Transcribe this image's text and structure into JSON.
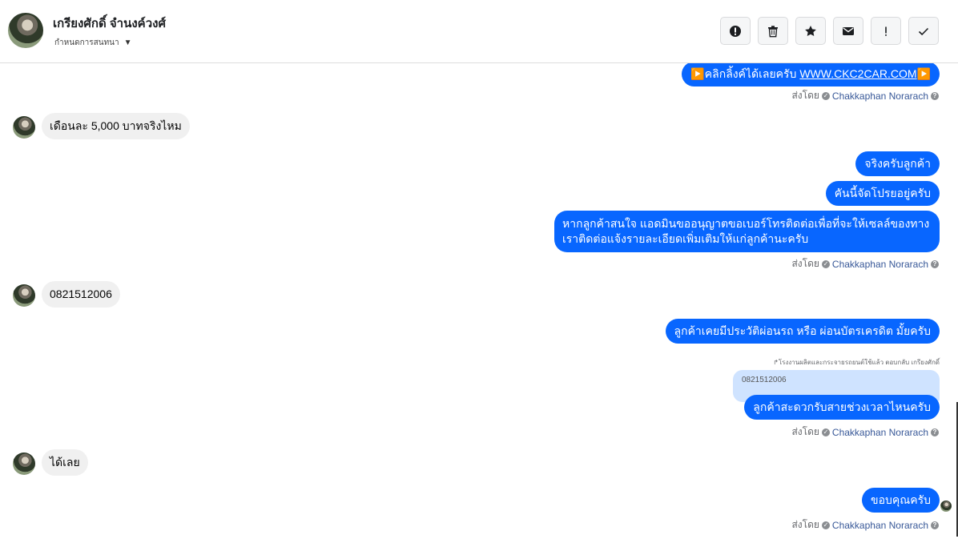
{
  "header": {
    "contact_name": "เกรียงศักดิ์ จำนงค์วงศ์",
    "assign_label": "กำหนดการสนทนา",
    "caret": "▼"
  },
  "toolbar": {
    "buttons": [
      {
        "name": "report",
        "icon": "alert-circle-icon"
      },
      {
        "name": "delete",
        "icon": "trash-icon"
      },
      {
        "name": "star",
        "icon": "star-icon"
      },
      {
        "name": "mail",
        "icon": "mail-icon"
      },
      {
        "name": "important",
        "icon": "exclamation-icon"
      },
      {
        "name": "done",
        "icon": "check-icon"
      }
    ]
  },
  "sent_by": {
    "prefix": "ส่งโดย",
    "agent": "Chakkaphan Norarach",
    "help": "?"
  },
  "messages": {
    "m1_prefix": "▶️คลิกลิ้งค์ได้เลยครับ ",
    "m1_link": "WWW.CKC2CAR.COM",
    "m1_suffix": "▶️",
    "m2": "เดือนละ 5,000 บาทจริงไหม",
    "m3": "จริงครับลูกค้า",
    "m4": "คันนี้จัดโปรยอยู่ครับ",
    "m5": "หากลูกค้าสนใจ แอดมินขออนุญาตขอเบอร์โทรติดต่อเพื่อที่จะให้เซลล์ของทางเราติดต่อแจ้งรายละเอียดเพิ่มเติมให้แก่ลูกค้านะครับ",
    "m6": "0821512006",
    "m7": "ลูกค้าเคยมีประวัติผ่อนรถ หรือ ผ่อนบัตรเครดิต มั้ยครับ",
    "reply_meta": "↱โรงงานผลิตและกระจายรถยนต์ใช้แล้ว ตอบกลับ เกรียงศักดิ์",
    "reply_quote": "0821512006",
    "m8": "ลูกค้าสะดวกรับสายช่วงเวลาไหนครับ",
    "m9": "ได้เลย",
    "m10": "ขอบคุณครับ"
  },
  "colors": {
    "outgoing": "#0866ff",
    "incoming": "#f0f0f0",
    "agent_link": "#385898"
  }
}
